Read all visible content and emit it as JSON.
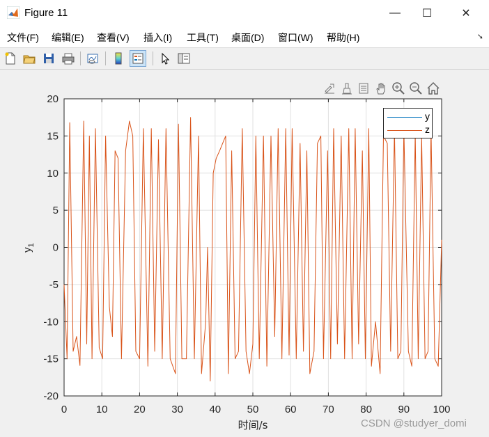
{
  "window": {
    "title": "Figure 11",
    "minimize_label": "—",
    "maximize_label": "☐",
    "close_label": "✕"
  },
  "menu": [
    "文件(F)",
    "编辑(E)",
    "查看(V)",
    "插入(I)",
    "工具(T)",
    "桌面(D)",
    "窗口(W)",
    "帮助(H)"
  ],
  "toolbar_icons": [
    "new-figure-icon",
    "open-file-icon",
    "save-icon",
    "print-icon",
    "link-plot-icon",
    "colorbar-icon",
    "legend-icon",
    "cursor-icon",
    "property-editor-icon"
  ],
  "axes_toolbar_icons": [
    "export-icon",
    "brush-icon",
    "datatips-icon",
    "pan-icon",
    "zoom-in-icon",
    "zoom-out-icon",
    "home-icon"
  ],
  "colors": {
    "y": "#0072bd",
    "z": "#d95319",
    "grid": "#e0e0e0",
    "axes": "#262626"
  },
  "watermark": "CSDN @studyer_domi",
  "chart_data": {
    "type": "line",
    "xlabel": "时间/s",
    "ylabel": "y1",
    "ylabel_main": "y",
    "ylabel_sub": "1",
    "xlim": [
      0,
      100
    ],
    "ylim": [
      -20,
      20
    ],
    "xticks": [
      0,
      10,
      20,
      30,
      40,
      50,
      60,
      70,
      80,
      90,
      100
    ],
    "yticks": [
      -20,
      -15,
      -10,
      -5,
      0,
      5,
      10,
      15,
      20
    ],
    "grid": true,
    "legend_position": "top-right",
    "series": [
      {
        "name": "y",
        "color": "#0072bd",
        "note": "hidden beneath z trace"
      },
      {
        "name": "z",
        "color": "#d95319",
        "points": [
          [
            0,
            -5
          ],
          [
            0.8,
            -15
          ],
          [
            1.5,
            16.8
          ],
          [
            2.4,
            -14
          ],
          [
            3.3,
            -12
          ],
          [
            4.2,
            -15.9
          ],
          [
            5.2,
            17
          ],
          [
            6,
            -13
          ],
          [
            6.7,
            15
          ],
          [
            7.4,
            -15
          ],
          [
            8.3,
            16
          ],
          [
            9.3,
            -13.5
          ],
          [
            10.2,
            -15
          ],
          [
            11,
            15
          ],
          [
            12,
            -8
          ],
          [
            12.8,
            -12
          ],
          [
            13.5,
            13
          ],
          [
            14.3,
            12
          ],
          [
            15.2,
            -15
          ],
          [
            16.3,
            13
          ],
          [
            17.3,
            17
          ],
          [
            18.2,
            15
          ],
          [
            19,
            -14
          ],
          [
            20,
            -15
          ],
          [
            21,
            16
          ],
          [
            22.2,
            -16
          ],
          [
            23.1,
            16
          ],
          [
            24,
            -14
          ],
          [
            25,
            14.5
          ],
          [
            26,
            -15
          ],
          [
            27,
            16
          ],
          [
            28.1,
            -15
          ],
          [
            29.5,
            -17
          ],
          [
            30.3,
            16.6
          ],
          [
            31.2,
            -15
          ],
          [
            32.4,
            -15
          ],
          [
            33.5,
            17.5
          ],
          [
            34.5,
            -15
          ],
          [
            35.6,
            15
          ],
          [
            36.4,
            -17
          ],
          [
            37.5,
            -10
          ],
          [
            38,
            0
          ],
          [
            38.7,
            -18
          ],
          [
            39.5,
            10
          ],
          [
            40.3,
            12
          ],
          [
            41.2,
            13
          ],
          [
            42,
            14
          ],
          [
            42.8,
            15
          ],
          [
            43.5,
            -17
          ],
          [
            44.4,
            13
          ],
          [
            45.3,
            -15
          ],
          [
            46.2,
            -14
          ],
          [
            47.2,
            16
          ],
          [
            48.2,
            -14
          ],
          [
            49.1,
            -17
          ],
          [
            50,
            -13
          ],
          [
            50.8,
            15
          ],
          [
            51.7,
            -15
          ],
          [
            52.8,
            15
          ],
          [
            53.7,
            -16
          ],
          [
            54.8,
            15
          ],
          [
            55.8,
            -12
          ],
          [
            56.7,
            16
          ],
          [
            57.7,
            -15
          ],
          [
            58.7,
            16
          ],
          [
            59.6,
            -14.5
          ],
          [
            60.4,
            16
          ],
          [
            61.5,
            -15
          ],
          [
            62.5,
            14
          ],
          [
            63.4,
            -14
          ],
          [
            64.3,
            13
          ],
          [
            65.1,
            -17
          ],
          [
            66.2,
            -14
          ],
          [
            67.1,
            14
          ],
          [
            68,
            15
          ],
          [
            68.7,
            -15
          ],
          [
            69.8,
            13
          ],
          [
            70.6,
            -15
          ],
          [
            71.4,
            16
          ],
          [
            72.4,
            -13
          ],
          [
            73.4,
            15
          ],
          [
            74.3,
            -15
          ],
          [
            75.4,
            16
          ],
          [
            76.3,
            -15
          ],
          [
            77.1,
            16
          ],
          [
            78,
            -13
          ],
          [
            79,
            13
          ],
          [
            79.8,
            -15
          ],
          [
            80.7,
            16
          ],
          [
            81.4,
            -16
          ],
          [
            82.5,
            -10
          ],
          [
            83.7,
            -17
          ],
          [
            84.6,
            15
          ],
          [
            85.6,
            14
          ],
          [
            86.5,
            -14
          ],
          [
            87.5,
            16
          ],
          [
            88.4,
            -15
          ],
          [
            89.2,
            -14
          ],
          [
            90,
            16
          ],
          [
            91.2,
            -14
          ],
          [
            92.1,
            -16
          ],
          [
            93,
            15.5
          ],
          [
            93.8,
            -15
          ],
          [
            94.7,
            15
          ],
          [
            95.6,
            -15
          ],
          [
            96.4,
            -14
          ],
          [
            97.2,
            16
          ],
          [
            98.2,
            -15
          ],
          [
            99.1,
            -16
          ],
          [
            100,
            1
          ]
        ]
      }
    ]
  }
}
